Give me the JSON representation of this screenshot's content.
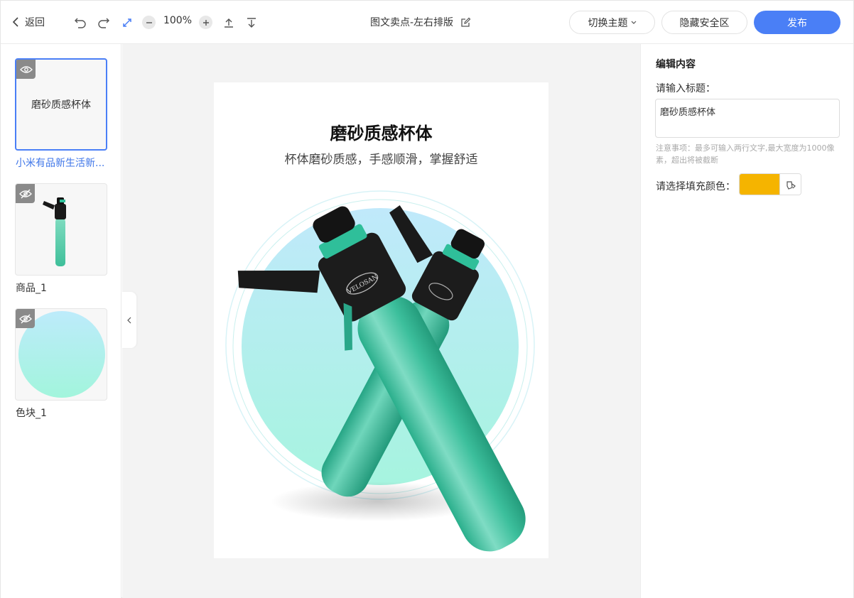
{
  "header": {
    "back_label": "返回",
    "zoom": "100%",
    "doc_title": "图文卖点-左右排版",
    "theme_label": "切换主题",
    "safe_area_label": "隐藏安全区",
    "publish_label": "发布"
  },
  "layers": [
    {
      "thumb_text": "磨砂质感杯体",
      "label": "小米有品新生活新...",
      "visible": true,
      "selected": true
    },
    {
      "thumb_text": "",
      "label": "商品_1",
      "visible": false,
      "selected": false
    },
    {
      "thumb_text": "",
      "label": "色块_1",
      "visible": false,
      "selected": false
    }
  ],
  "poster": {
    "title": "磨砂质感杯体",
    "subtitle": "杯体磨砂质感，手感顺滑，掌握舒适",
    "brand": "VELOSAN"
  },
  "panel": {
    "heading": "编辑内容",
    "title_label": "请输入标题：",
    "title_value": "磨砂质感杯体",
    "note": "注意事项：最多可输入两行文字,最大宽度为1000像素，超出将被截断",
    "color_label": "请选择填充颜色：",
    "fill_color": "#f5b400"
  },
  "colors": {
    "accent": "#4a7ff6",
    "bottle": "#2fbf9a",
    "circle_top": "#bdebfb",
    "circle_bottom": "#a9f3df"
  }
}
